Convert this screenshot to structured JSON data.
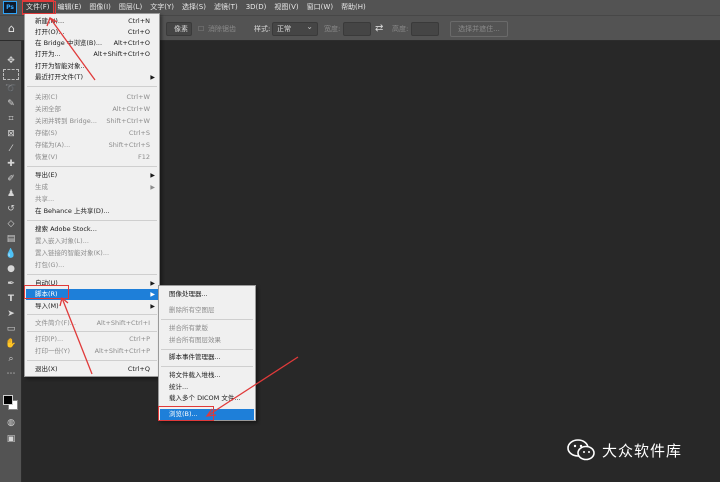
{
  "app": {
    "logo": "Ps"
  },
  "menubar": {
    "items": [
      "文件(F)",
      "编辑(E)",
      "图像(I)",
      "图层(L)",
      "文字(Y)",
      "选择(S)",
      "滤镜(T)",
      "3D(D)",
      "视图(V)",
      "窗口(W)",
      "帮助(H)"
    ]
  },
  "options": {
    "pixel_label": "像素",
    "antialias": "消除锯齿",
    "style_label": "样式:",
    "style_value": "正常",
    "width_label": "宽度:",
    "height_label": "高度:",
    "mask_button": "选择并遮住..."
  },
  "file_menu": {
    "items": [
      {
        "label": "新建(N)...",
        "shortcut": "Ctrl+N",
        "disabled": false,
        "submenu": false
      },
      {
        "label": "打开(O)...",
        "shortcut": "Ctrl+O",
        "disabled": false,
        "submenu": false
      },
      {
        "label": "在 Bridge 中浏览(B)...",
        "shortcut": "Alt+Ctrl+O",
        "disabled": false,
        "submenu": false
      },
      {
        "label": "打开为...",
        "shortcut": "Alt+Shift+Ctrl+O",
        "disabled": false,
        "submenu": false
      },
      {
        "label": "打开为智能对象...",
        "shortcut": "",
        "disabled": false,
        "submenu": false
      },
      {
        "label": "最近打开文件(T)",
        "shortcut": "",
        "disabled": false,
        "submenu": true
      },
      {
        "label": "关闭(C)",
        "shortcut": "Ctrl+W",
        "disabled": true,
        "submenu": false
      },
      {
        "label": "关闭全部",
        "shortcut": "Alt+Ctrl+W",
        "disabled": true,
        "submenu": false
      },
      {
        "label": "关闭并转到 Bridge...",
        "shortcut": "Shift+Ctrl+W",
        "disabled": true,
        "submenu": false
      },
      {
        "label": "存储(S)",
        "shortcut": "Ctrl+S",
        "disabled": true,
        "submenu": false
      },
      {
        "label": "存储为(A)...",
        "shortcut": "Shift+Ctrl+S",
        "disabled": true,
        "submenu": false
      },
      {
        "label": "恢复(V)",
        "shortcut": "F12",
        "disabled": true,
        "submenu": false
      },
      {
        "label": "导出(E)",
        "shortcut": "",
        "disabled": false,
        "submenu": true
      },
      {
        "label": "生成",
        "shortcut": "",
        "disabled": true,
        "submenu": true
      },
      {
        "label": "共享...",
        "shortcut": "",
        "disabled": true,
        "submenu": false
      },
      {
        "label": "在 Behance 上共享(D)...",
        "shortcut": "",
        "disabled": false,
        "submenu": false
      },
      {
        "label": "搜索 Adobe Stock...",
        "shortcut": "",
        "disabled": false,
        "submenu": false
      },
      {
        "label": "置入嵌入对象(L)...",
        "shortcut": "",
        "disabled": true,
        "submenu": false
      },
      {
        "label": "置入链接的智能对象(K)...",
        "shortcut": "",
        "disabled": true,
        "submenu": false
      },
      {
        "label": "打包(G)...",
        "shortcut": "",
        "disabled": true,
        "submenu": false
      },
      {
        "label": "自动(U)",
        "shortcut": "",
        "disabled": false,
        "submenu": true
      },
      {
        "label": "脚本(R)",
        "shortcut": "",
        "disabled": false,
        "submenu": true
      },
      {
        "label": "导入(M)",
        "shortcut": "",
        "disabled": false,
        "submenu": true
      },
      {
        "label": "文件简介(F)...",
        "shortcut": "Alt+Shift+Ctrl+I",
        "disabled": true,
        "submenu": false
      },
      {
        "label": "打印(P)...",
        "shortcut": "Ctrl+P",
        "disabled": true,
        "submenu": false
      },
      {
        "label": "打印一份(Y)",
        "shortcut": "Alt+Shift+Ctrl+P",
        "disabled": true,
        "submenu": false
      },
      {
        "label": "退出(X)",
        "shortcut": "Ctrl+Q",
        "disabled": false,
        "submenu": false
      }
    ]
  },
  "scripts_menu": {
    "items": [
      {
        "label": "图像处理器...",
        "disabled": false
      },
      {
        "label": "删除所有空图层",
        "disabled": true
      },
      {
        "label": "拼合所有蒙版",
        "disabled": true
      },
      {
        "label": "拼合所有图层效果",
        "disabled": true
      },
      {
        "label": "脚本事件管理器...",
        "disabled": false
      },
      {
        "label": "将文件载入堆栈...",
        "disabled": false
      },
      {
        "label": "统计...",
        "disabled": false
      },
      {
        "label": "载入多个 DICOM 文件...",
        "disabled": false
      },
      {
        "label": "浏览(B)...",
        "disabled": false
      }
    ]
  },
  "watermark": {
    "text": "大众软件库"
  },
  "colors": {
    "highlight": "#1e7fd9",
    "annotation": "#e03a3a"
  }
}
